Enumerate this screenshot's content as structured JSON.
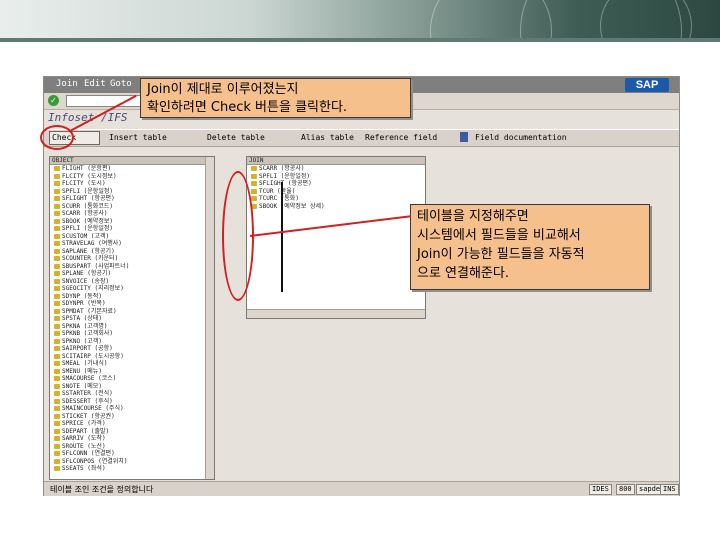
{
  "banner": {
    "accent_color": "#2c4841"
  },
  "sap": {
    "menu": [
      "Join",
      "Edit",
      "Goto"
    ],
    "logo": "SAP",
    "screen_title": "Infoset /IFS",
    "toolbar": {
      "check_label": "Check",
      "insert_table": "Insert table",
      "delete_table": "Delete table",
      "alias_table": "Alias table",
      "reference_field": "Reference field",
      "field_documentation": "Field documentation"
    },
    "left_panel": {
      "header": "OBJECT",
      "items": [
        "FLIGHT (운항편)",
        "FLCITY (도시정보)",
        "FLCITY (도시)",
        "SPFLI (운항일정)",
        "SFLIGHT (항공편)",
        "SCURR (통화코드)",
        "SCARR (항공사)",
        "SBOOK (예약정보)",
        "SPFLI (운항일정)",
        "SCUSTOM (고객)",
        "STRAVELAG (여행사)",
        "SAPLANE (항공기)",
        "SCOUNTER (카운터)",
        "SBUSPART (사업파트너)",
        "SPLANE (항공기)",
        "SNVOICE (송장)",
        "SGEOCITY (지리정보)",
        "SDYNP (동적)",
        "SDYNPR (반복)",
        "SPMDAT (기본자료)",
        "SPSTA (상태)",
        "SPKNA (고객명)",
        "SPKNB (고객회사)",
        "SPKNO (고객)",
        "SAIRPORT (공항)",
        "SCITAIRP (도시공항)",
        "SMEAL (기내식)",
        "SMENU (메뉴)",
        "SMACOURSE (코스)",
        "SNOTE (메모)",
        "SSTARTER (전식)",
        "SDESSERT (후식)",
        "SMAINCOURSE (주식)",
        "STICKET (항공권)",
        "SPRICE (가격)",
        "SDEPART (출발)",
        "SARRIV (도착)",
        "SROUTE (노선)",
        "SFLCONN (연결편)",
        "SFLCONPOS (연결위치)",
        "SSEATS (좌석)",
        "SPAYMENT (지불)",
        "SRECEIPT (영수증)",
        "STAX (세금)",
        "SCREDIT (신용)",
        "SDEBIT (차변)",
        "SLEDGER (원장)",
        "SREPORT (보고서)",
        "SAUDIT (감사)",
        "SLOG (기록)"
      ]
    },
    "right_panel": {
      "header": "JOIN",
      "items": [
        "SCARR (항공사)",
        "SPFLI (운항일정)",
        "SFLIGHT (항공편)",
        "TCUR (환율)",
        "TCURC (통화)",
        "SBOOK (예약정보 상세)"
      ]
    },
    "status": {
      "text": "테이블 조인 조건을 정의합니다",
      "system": "IDES",
      "client": "800",
      "server": "sapdev",
      "mode": "INS"
    }
  },
  "callouts": {
    "top": {
      "lines": [
        "Join이 제대로 이루어졌는지",
        "확인하려면 Check 버튼을 클릭한다."
      ]
    },
    "right": {
      "lines": [
        "테이블을 지정해주면",
        "시스템에서 필드들을 비교해서",
        "Join이 가능한 필드들을 자동적",
        "으로 연결해준다."
      ]
    },
    "fill_color": "#f6c08d",
    "highlight_color": "#d21f1f"
  }
}
